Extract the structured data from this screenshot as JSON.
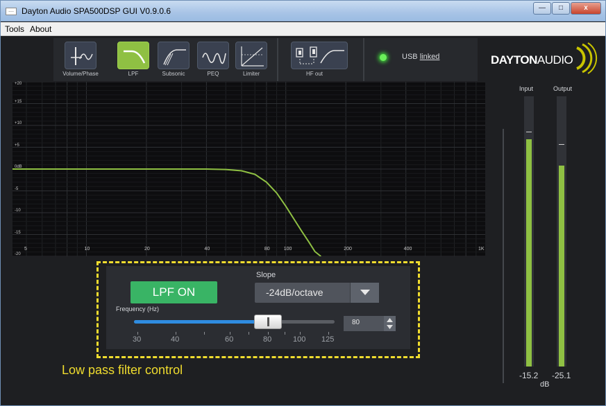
{
  "window": {
    "title": "Dayton Audio SPA500DSP GUI V0.9.0.6",
    "app_icon_glyph": "....",
    "minimize_glyph": "—",
    "maximize_glyph": "□",
    "close_glyph": "x"
  },
  "menu": {
    "items": [
      "Tools",
      "About"
    ]
  },
  "toolbar": {
    "tools": [
      {
        "label": "Volume/Phase",
        "icon": "volume-phase-icon",
        "active": false
      },
      {
        "label": "LPF",
        "icon": "lpf-icon",
        "active": true
      },
      {
        "label": "Subsonic",
        "icon": "subsonic-icon",
        "active": false
      },
      {
        "label": "PEQ",
        "icon": "peq-icon",
        "active": false
      },
      {
        "label": "Limiter",
        "icon": "limiter-icon",
        "active": false
      },
      {
        "label": "HF out",
        "icon": "hf-out-icon",
        "active": false
      }
    ]
  },
  "usb": {
    "prefix": "USB",
    "status": "linked",
    "led_color": "#6bf05a"
  },
  "logo": {
    "bold": "DAYTON",
    "light": "AUDIO"
  },
  "chart_data": {
    "type": "line",
    "title": "",
    "xlabel": "",
    "ylabel": "",
    "x_scale": "log",
    "xlim": [
      5,
      1000
    ],
    "ylim": [
      -20,
      20
    ],
    "x_tick_labels": [
      "5",
      "10",
      "20",
      "40",
      "80",
      "100",
      "200",
      "400",
      "1K"
    ],
    "y_tick_labels": [
      "+20",
      "+15",
      "+10",
      "+5",
      "0dB",
      "-5",
      "-10",
      "-15",
      "-20"
    ],
    "series": [
      {
        "color": "#8fc043",
        "x": [
          5,
          10,
          20,
          30,
          40,
          50,
          60,
          70,
          80,
          90,
          100,
          110,
          120,
          130,
          140,
          150
        ],
        "y": [
          0,
          0,
          0,
          0,
          0,
          -0.1,
          -0.4,
          -1.2,
          -3,
          -5.5,
          -8.5,
          -11.5,
          -14.2,
          -16.6,
          -18.9,
          -20
        ]
      }
    ],
    "grid": true
  },
  "lpf": {
    "button_label": "LPF ON",
    "slope_label": "Slope",
    "slope_value": "-24dB/octave",
    "frequency_label": "Frequency (Hz)",
    "frequency_value": "80",
    "slider_ticks": [
      "30",
      "40",
      "60",
      "80",
      "100",
      "125"
    ],
    "slider_position_hz": 80
  },
  "annotation": "Low pass filter control",
  "annotation_color": "#f0dc2e",
  "meters": {
    "input_label": "Input",
    "output_label": "Output",
    "input_value": "-15.2",
    "output_value": "-25.1",
    "unit": "dB"
  }
}
